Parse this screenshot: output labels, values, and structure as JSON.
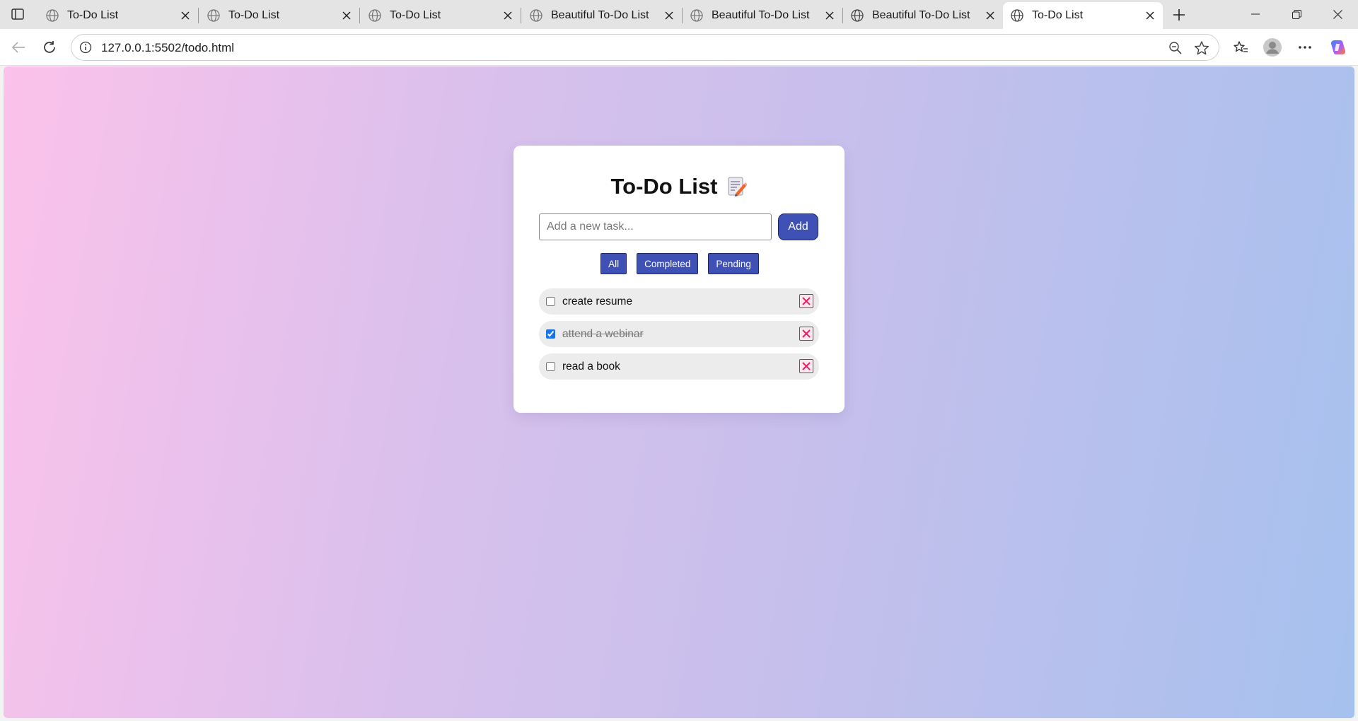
{
  "browser": {
    "tabs": [
      {
        "label": "To-Do List",
        "active": false
      },
      {
        "label": "To-Do List",
        "active": false
      },
      {
        "label": "To-Do List",
        "active": false
      },
      {
        "label": "Beautiful To-Do List",
        "active": false
      },
      {
        "label": "Beautiful To-Do List",
        "active": false
      },
      {
        "label": "Beautiful To-Do List",
        "active": false
      },
      {
        "label": "To-Do List",
        "active": true
      }
    ],
    "url": "127.0.0.1:5502/todo.html",
    "icons": [
      "sidebar-icon",
      "globe-icon",
      "close-icon",
      "plus-icon",
      "minimize-icon",
      "restore-icon",
      "back-icon",
      "reload-icon",
      "info-icon",
      "zoom-out-icon",
      "star-icon",
      "favorites-icon",
      "profile-icon",
      "more-icon",
      "copilot-icon"
    ]
  },
  "app": {
    "title": "To-Do List",
    "title_emoji": "memo-icon",
    "input": {
      "placeholder": "Add a new task...",
      "value": ""
    },
    "add_label": "Add",
    "filters": [
      {
        "label": "All"
      },
      {
        "label": "Completed"
      },
      {
        "label": "Pending"
      }
    ],
    "tasks": [
      {
        "text": "create resume",
        "completed": false
      },
      {
        "text": "attend a webinar",
        "completed": true
      },
      {
        "text": "read a book",
        "completed": false
      }
    ],
    "colors": {
      "accent": "#3f51b5",
      "item_bg": "#ececec",
      "delete_x": "#e91e63",
      "gradient_start": "#fbc2eb",
      "gradient_end": "#a6c1ee"
    }
  }
}
